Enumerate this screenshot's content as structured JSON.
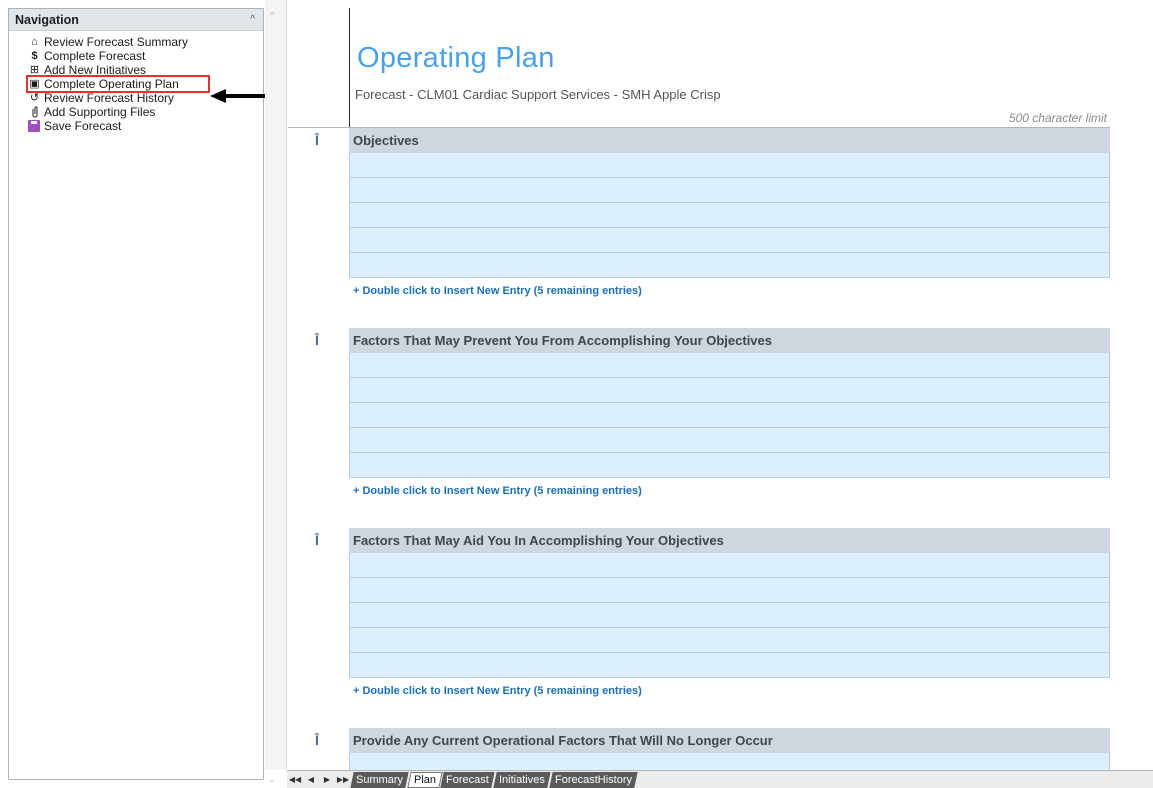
{
  "navigation": {
    "title": "Navigation",
    "collapse_glyph": "^",
    "items": [
      {
        "label": "Review Forecast Summary",
        "icon": "home-icon",
        "glyph": "⌂"
      },
      {
        "label": "Complete Forecast",
        "icon": "dollar-icon",
        "glyph": "$"
      },
      {
        "label": "Add New Initiatives",
        "icon": "plus-box-icon",
        "glyph": "⊞"
      },
      {
        "label": "Complete Operating Plan",
        "icon": "book-icon",
        "glyph": "▣"
      },
      {
        "label": "Review Forecast History",
        "icon": "history-icon",
        "glyph": "↺"
      },
      {
        "label": "Add Supporting Files",
        "icon": "paperclip-icon",
        "glyph": "⊘"
      },
      {
        "label": "Save Forecast",
        "icon": "save-icon",
        "glyph": ""
      }
    ],
    "active_index": 3,
    "highlight_color": "#e0342f"
  },
  "page": {
    "title": "Operating Plan",
    "subtitle": "Forecast - CLM01 Cardiac Support Services - SMH Apple Crisp",
    "char_limit": "500 character limit",
    "title_color": "#4aa1e8"
  },
  "sections": [
    {
      "header": "Objectives",
      "marker": "Ī",
      "link": "+ Double click to Insert New Entry (5 remaining entries)"
    },
    {
      "header": "Factors That May Prevent You From Accomplishing Your Objectives",
      "marker": "Ī",
      "link": "+ Double click to Insert New Entry (5 remaining entries)"
    },
    {
      "header": "Factors That May Aid You In Accomplishing Your Objectives",
      "marker": "Ī",
      "link": "+ Double click to Insert New Entry (5 remaining entries)"
    },
    {
      "header": "Provide Any Current Operational Factors That Will No Longer Occur",
      "marker": "Ī"
    }
  ],
  "sheet_tabs": {
    "nav": [
      "◀◀",
      "◀",
      "▶",
      "▶▶"
    ],
    "tabs": [
      "Summary",
      "Plan",
      "Forecast",
      "Initiatives",
      "ForecastHistory"
    ],
    "active": "Plan"
  },
  "colors": {
    "section_header_bg": "#cfd6dd",
    "entry_bg": "#dcefff",
    "link_color": "#1d6fb8"
  }
}
